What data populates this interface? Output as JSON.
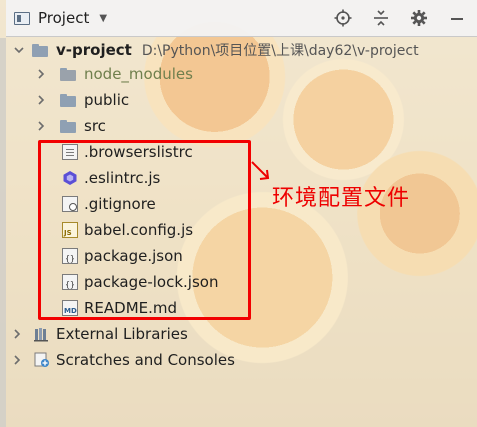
{
  "header": {
    "title": "Project",
    "tools": [
      "target-icon",
      "collapse-icon",
      "gear-icon",
      "minimize-icon"
    ]
  },
  "tree": {
    "root": {
      "name": "v-project",
      "path": "D:\\Python\\项目位置\\上课\\day62\\v-project"
    },
    "folders": [
      {
        "name": "node_modules"
      },
      {
        "name": "public"
      },
      {
        "name": "src"
      }
    ],
    "files": [
      {
        "name": ".browserslistrc",
        "icon": "text-file-icon"
      },
      {
        "name": ".eslintrc.js",
        "icon": "eslint-icon"
      },
      {
        "name": ".gitignore",
        "icon": "ignore-file-icon"
      },
      {
        "name": "babel.config.js",
        "icon": "js-file-icon"
      },
      {
        "name": "package.json",
        "icon": "json-file-icon"
      },
      {
        "name": "package-lock.json",
        "icon": "json-file-icon"
      },
      {
        "name": "README.md",
        "icon": "markdown-file-icon"
      }
    ],
    "external_libraries": "External Libraries",
    "scratches": "Scratches and Consoles"
  },
  "annotation": {
    "text": "环境配置文件",
    "color": "#ee0000"
  }
}
